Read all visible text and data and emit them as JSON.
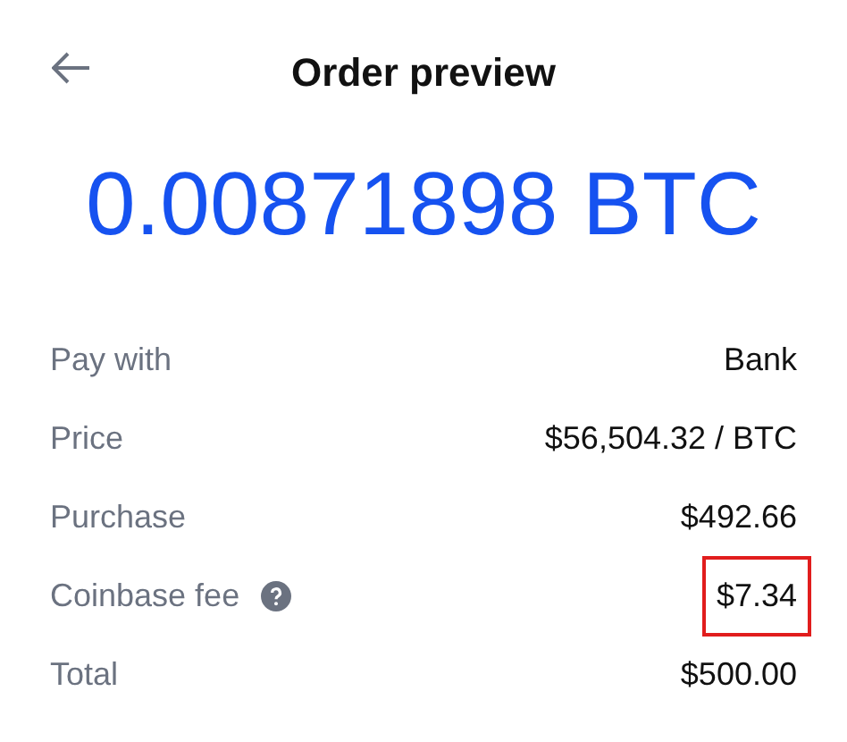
{
  "header": {
    "title": "Order preview"
  },
  "amount": "0.00871898 BTC",
  "rows": [
    {
      "label": "Pay with",
      "value": "Bank",
      "help": false,
      "highlighted": false
    },
    {
      "label": "Price",
      "value": "$56,504.32 / BTC",
      "help": false,
      "highlighted": false
    },
    {
      "label": "Purchase",
      "value": "$492.66",
      "help": false,
      "highlighted": false
    },
    {
      "label": "Coinbase fee",
      "value": "$7.34",
      "help": true,
      "highlighted": true
    },
    {
      "label": "Total",
      "value": "$500.00",
      "help": false,
      "highlighted": false
    }
  ]
}
